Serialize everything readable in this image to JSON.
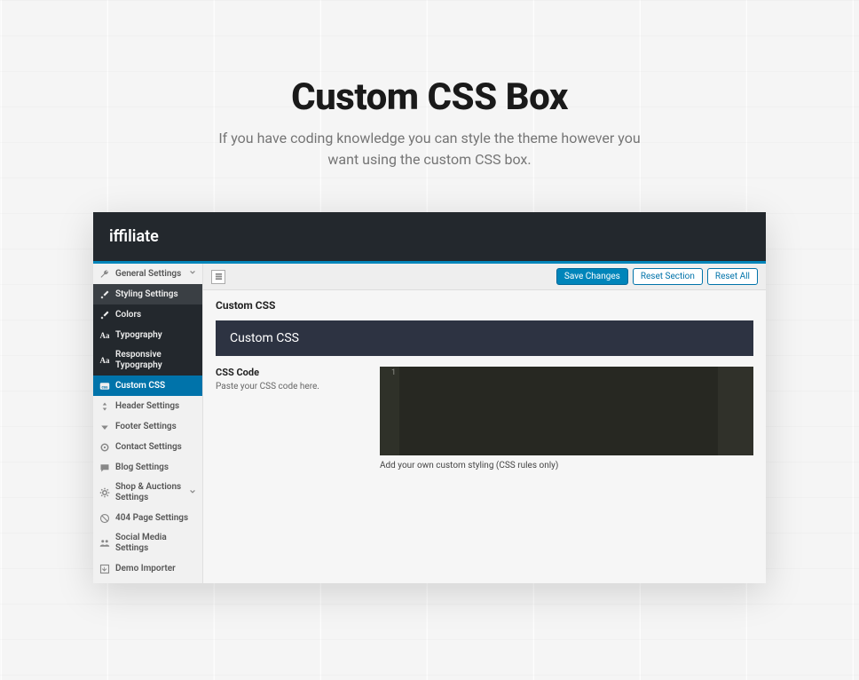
{
  "hero": {
    "title": "Custom CSS Box",
    "subtitle": "If you have coding knowledge you can style the theme however you want using the custom CSS box."
  },
  "header": {
    "brand": "iffiliate"
  },
  "sidebar": {
    "items": [
      {
        "label": "General Settings",
        "icon": "wrench",
        "style": "light",
        "chevron": true
      },
      {
        "label": "Styling Settings",
        "icon": "brush",
        "style": "dark-sel"
      },
      {
        "label": "Colors",
        "icon": "brush",
        "style": "dark"
      },
      {
        "label": "Typography",
        "icon": "aa",
        "style": "dark"
      },
      {
        "label": "Responsive Typography",
        "icon": "aa",
        "style": "dark"
      },
      {
        "label": "Custom CSS",
        "icon": "css",
        "style": "blue"
      },
      {
        "label": "Header Settings",
        "icon": "updown",
        "style": "light"
      },
      {
        "label": "Footer Settings",
        "icon": "down",
        "style": "light"
      },
      {
        "label": "Contact Settings",
        "icon": "target",
        "style": "light"
      },
      {
        "label": "Blog Settings",
        "icon": "chat",
        "style": "light"
      },
      {
        "label": "Shop & Auctions Settings",
        "icon": "gear",
        "style": "light",
        "chevron": true
      },
      {
        "label": "404 Page Settings",
        "icon": "block",
        "style": "light"
      },
      {
        "label": "Social Media Settings",
        "icon": "people",
        "style": "light"
      },
      {
        "label": "Demo Importer",
        "icon": "import",
        "style": "light"
      }
    ]
  },
  "toolbar": {
    "save": "Save Changes",
    "reset_section": "Reset Section",
    "reset_all": "Reset All"
  },
  "content": {
    "section_title": "Custom CSS",
    "banner": "Custom CSS",
    "css_code_label": "CSS Code",
    "css_code_hint": "Paste your CSS code here.",
    "editor_line": "1",
    "help_text": "Add your own custom styling (CSS rules only)"
  }
}
